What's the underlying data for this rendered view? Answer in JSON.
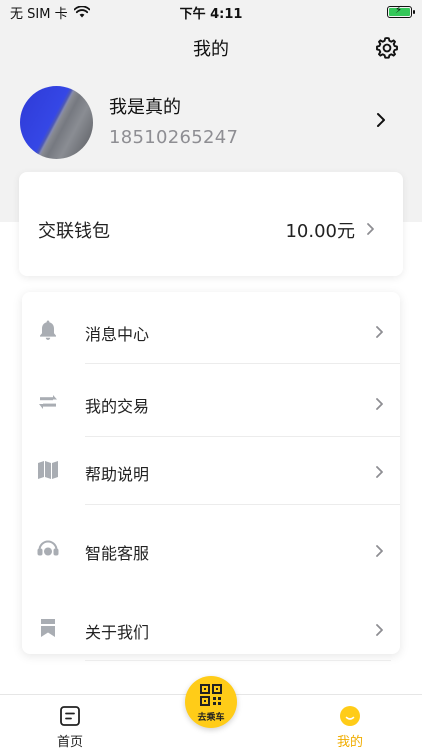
{
  "status_bar": {
    "carrier": "无 SIM 卡",
    "time": "下午 4:11"
  },
  "header": {
    "title": "我的",
    "settings_icon": "gear-icon"
  },
  "profile": {
    "name": "我是真的",
    "phone": "18510265247"
  },
  "wallet": {
    "label": "交联钱包",
    "amount": "10.00元"
  },
  "menu": {
    "items": [
      {
        "label": "消息中心",
        "icon": "bell-icon"
      },
      {
        "label": "我的交易",
        "icon": "transfer-icon"
      },
      {
        "label": "帮助说明",
        "icon": "book-icon"
      },
      {
        "label": "智能客服",
        "icon": "headset-icon"
      },
      {
        "label": "关于我们",
        "icon": "bookmark-icon"
      }
    ]
  },
  "tab_bar": {
    "home_label": "首页",
    "ride_label": "去乘车",
    "mine_label": "我的"
  },
  "colors": {
    "accent": "#ffcc18",
    "active_tab": "#f0ad00",
    "icon_gray": "#a9adb3"
  }
}
